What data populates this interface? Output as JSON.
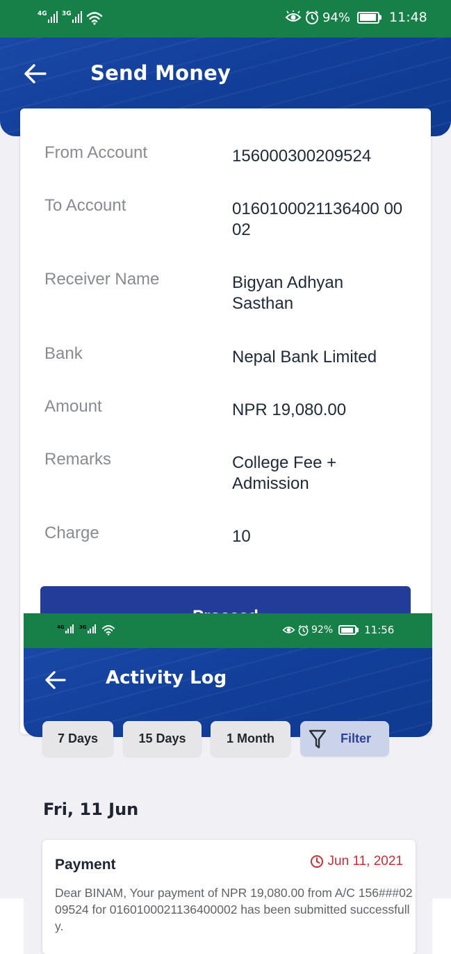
{
  "screen1": {
    "status": {
      "net1": "4G",
      "net2": "3G",
      "battery": "94%",
      "battery_level": 0.94,
      "time": "11:48"
    },
    "title": "Send Money",
    "fields": [
      {
        "label": "From Account",
        "value": "156000300209524"
      },
      {
        "label": "To Account",
        "value": "0160100021136400 0002"
      },
      {
        "label": "Receiver Name",
        "value": "Bigyan Adhyan Sasthan"
      },
      {
        "label": "Bank",
        "value": "Nepal Bank Limited"
      },
      {
        "label": "Amount",
        "value": "NPR 19,080.00"
      },
      {
        "label": "Remarks",
        "value": "College Fee + Admission"
      },
      {
        "label": "Charge",
        "value": "10"
      }
    ],
    "proceed_label": "Proceed"
  },
  "screen2": {
    "status": {
      "net1": "4G",
      "net2": "3G",
      "battery": "92%",
      "battery_level": 0.92,
      "time": "11:56"
    },
    "title": "Activity Log",
    "chips": [
      "7 Days",
      "15 Days",
      "1 Month"
    ],
    "filter_label": "Filter",
    "date_heading": "Fri, 11 Jun",
    "entry": {
      "title": "Payment",
      "date": "Jun 11, 2021",
      "message": "Dear BINAM, Your payment of NPR 19,080.00 from A/C 156###0209524 for 0160100021136400002 has been submitted successfully."
    }
  },
  "colors": {
    "status_green": "#178049",
    "header_blue": "#123f9a",
    "button_blue": "#233c99",
    "alert_red": "#c62f34"
  }
}
